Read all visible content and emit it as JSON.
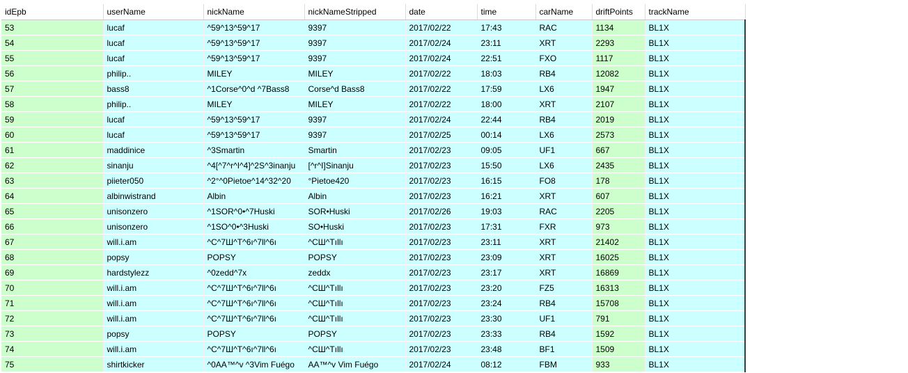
{
  "columns": [
    {
      "key": "idEpb",
      "label": "idEpb",
      "kind": "num"
    },
    {
      "key": "userName",
      "label": "userName",
      "kind": "txt"
    },
    {
      "key": "nickName",
      "label": "nickName",
      "kind": "txt"
    },
    {
      "key": "nickNameStripped",
      "label": "nickNameStripped",
      "kind": "txt"
    },
    {
      "key": "date",
      "label": "date",
      "kind": "txt"
    },
    {
      "key": "time",
      "label": "time",
      "kind": "txt"
    },
    {
      "key": "carName",
      "label": "carName",
      "kind": "txt"
    },
    {
      "key": "driftPoints",
      "label": "driftPoints",
      "kind": "num"
    },
    {
      "key": "trackName",
      "label": "trackName",
      "kind": "txt"
    }
  ],
  "colors": {
    "numeric_cell_bg": "#ccffcc",
    "text_cell_bg": "#ccffff",
    "header_bg": "#ffffff"
  },
  "rows": [
    [
      "53",
      "lucaf",
      "^59^13^59^17",
      "9397",
      "2017/02/22",
      "17:43",
      "RAC",
      "1134",
      "BL1X"
    ],
    [
      "54",
      "lucaf",
      "^59^13^59^17",
      "9397",
      "2017/02/24",
      "23:11",
      "XRT",
      "2293",
      "BL1X"
    ],
    [
      "55",
      "lucaf",
      "^59^13^59^17",
      "9397",
      "2017/02/24",
      "22:51",
      "FXO",
      "1117",
      "BL1X"
    ],
    [
      "56",
      "philip..",
      "MILEY",
      "MILEY",
      "2017/02/22",
      "18:03",
      "RB4",
      "12082",
      "BL1X"
    ],
    [
      "57",
      "bass8",
      "^1Corse^0^d ^7Bass8",
      "Corse^d Bass8",
      "2017/02/22",
      "17:59",
      "LX6",
      "1947",
      "BL1X"
    ],
    [
      "58",
      "philip..",
      "MILEY",
      "MILEY",
      "2017/02/22",
      "18:00",
      "XRT",
      "2107",
      "BL1X"
    ],
    [
      "59",
      "lucaf",
      "^59^13^59^17",
      "9397",
      "2017/02/24",
      "22:44",
      "RB4",
      "2019",
      "BL1X"
    ],
    [
      "60",
      "lucaf",
      "^59^13^59^17",
      "9397",
      "2017/02/25",
      "00:14",
      "LX6",
      "2573",
      "BL1X"
    ],
    [
      "61",
      "maddinice",
      "^3Smartin",
      "Smartin",
      "2017/02/23",
      "09:05",
      "UF1",
      "667",
      "BL1X"
    ],
    [
      "62",
      "sinanju",
      "^4[^7^r^I^4]^2S^3inanju",
      "[^r^I]Sinanju",
      "2017/02/23",
      "15:50",
      "LX6",
      "2435",
      "BL1X"
    ],
    [
      "63",
      "piieter050",
      "^2°^0Pietoe^14^32^20",
      "°Pietoe420",
      "2017/02/23",
      "16:15",
      "FO8",
      "178",
      "BL1X"
    ],
    [
      "64",
      "albinwistrand",
      "Albin",
      "Albin",
      "2017/02/23",
      "16:21",
      "XRT",
      "607",
      "BL1X"
    ],
    [
      "65",
      "unisonzero",
      "^1SOR^0•^7Huski",
      "SOR•Huski",
      "2017/02/26",
      "19:03",
      "RAC",
      "2205",
      "BL1X"
    ],
    [
      "66",
      "unisonzero",
      "^1SO^0•^3Huski",
      "SO•Huski",
      "2017/02/23",
      "17:31",
      "FXR",
      "973",
      "BL1X"
    ],
    [
      "67",
      "will.i.am",
      "^C^7Ш^T^6ı^7ll^6ı",
      "^CШ^Tıllı",
      "2017/02/23",
      "23:11",
      "XRT",
      "21402",
      "BL1X"
    ],
    [
      "68",
      "popsy",
      "POPSY",
      "POPSY",
      "2017/02/23",
      "23:09",
      "XRT",
      "16025",
      "BL1X"
    ],
    [
      "69",
      "hardstylezz",
      "^0zedd^7x",
      "zeddx",
      "2017/02/23",
      "23:17",
      "XRT",
      "16869",
      "BL1X"
    ],
    [
      "70",
      "will.i.am",
      "^C^7Ш^T^6ı^7ll^6ı",
      "^CШ^Tıllı",
      "2017/02/23",
      "23:20",
      "FZ5",
      "16313",
      "BL1X"
    ],
    [
      "71",
      "will.i.am",
      "^C^7Ш^T^6ı^7ll^6ı",
      "^CШ^Tıllı",
      "2017/02/23",
      "23:24",
      "RB4",
      "15708",
      "BL1X"
    ],
    [
      "72",
      "will.i.am",
      "^C^7Ш^T^6ı^7ll^6ı",
      "^CШ^Tıllı",
      "2017/02/23",
      "23:30",
      "UF1",
      "791",
      "BL1X"
    ],
    [
      "73",
      "popsy",
      "POPSY",
      "POPSY",
      "2017/02/23",
      "23:33",
      "RB4",
      "1592",
      "BL1X"
    ],
    [
      "74",
      "will.i.am",
      "^C^7Ш^T^6ı^7ll^6ı",
      "^CШ^Tıllı",
      "2017/02/23",
      "23:48",
      "BF1",
      "1509",
      "BL1X"
    ],
    [
      "75",
      "shirtkicker",
      "^0AA™^v ^3Vim Fuégo",
      "AA™^v Vim Fuégo",
      "2017/02/24",
      "08:12",
      "FBM",
      "933",
      "BL1X"
    ]
  ]
}
